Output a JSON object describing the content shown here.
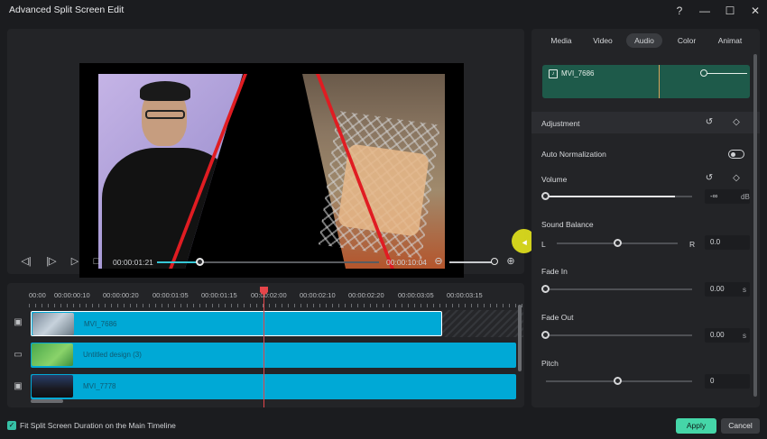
{
  "window": {
    "title": "Advanced Split Screen Edit"
  },
  "window_controls": {
    "help": "?",
    "minimize": "—",
    "maximize": "☐",
    "close": "✕"
  },
  "playback": {
    "current_time": "00:00:01:21",
    "total_time": "00:00:10:04",
    "progress": 0.19,
    "zoom_level": 0.9
  },
  "timeline": {
    "ruler": [
      "00:00",
      "00:00:00:10",
      "00:00:00:20",
      "00:00:01:05",
      "00:00:01:15",
      "00:00:02:00",
      "00:00:02:10",
      "00:00:02:20",
      "00:00:03:05",
      "00:00:03:15"
    ],
    "tracks": [
      {
        "name": "MVI_7686"
      },
      {
        "name": "Untitled design (3)"
      },
      {
        "name": "MVI_7778"
      }
    ]
  },
  "footer": {
    "fit_label": "Fit Split Screen Duration on the Main Timeline",
    "apply": "Apply",
    "cancel": "Cancel"
  },
  "panel": {
    "tabs": [
      "Media",
      "Video",
      "Audio",
      "Color",
      "Animat"
    ],
    "active_tab": "Audio",
    "audio_clip": "MVI_7686",
    "adjustment": "Adjustment",
    "auto_normalization": "Auto Normalization",
    "volume": {
      "label": "Volume",
      "value": "-∞",
      "unit": "dB",
      "level": 0.0
    },
    "sound_balance": {
      "label": "Sound Balance",
      "left": "L",
      "right": "R",
      "value": "0.0",
      "level": 0.5
    },
    "fade_in": {
      "label": "Fade In",
      "value": "0.00",
      "unit": "s"
    },
    "fade_out": {
      "label": "Fade Out",
      "value": "0.00",
      "unit": "s"
    },
    "pitch": {
      "label": "Pitch",
      "value": "0",
      "level": 0.5
    }
  },
  "colors": {
    "accent": "#45d6a8",
    "clip": "#00a9d6",
    "playhead": "#e6454a",
    "audio_clip_bg": "#1e5a4a"
  }
}
